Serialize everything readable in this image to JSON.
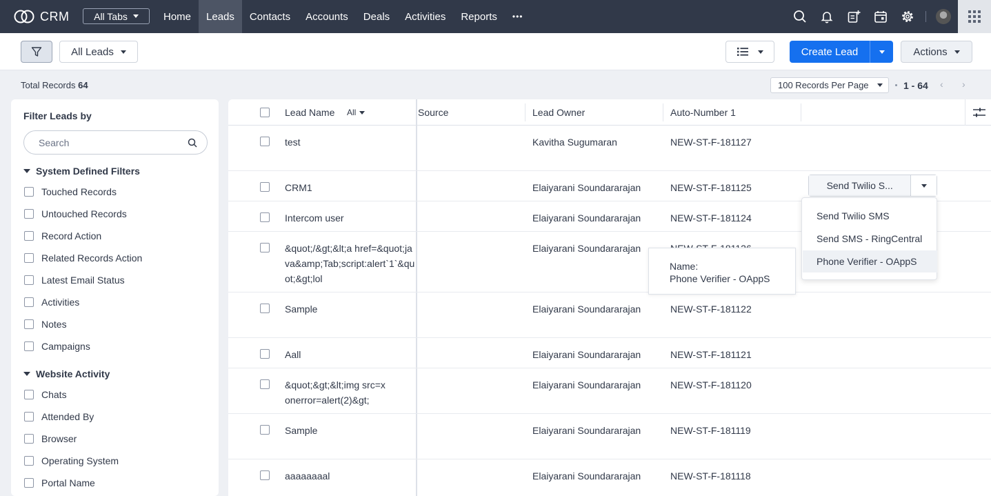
{
  "app": {
    "title": "CRM",
    "all_tabs_label": "All Tabs"
  },
  "nav": {
    "items": [
      {
        "label": "Home",
        "active": false
      },
      {
        "label": "Leads",
        "active": true
      },
      {
        "label": "Contacts",
        "active": false
      },
      {
        "label": "Accounts",
        "active": false
      },
      {
        "label": "Deals",
        "active": false
      },
      {
        "label": "Activities",
        "active": false
      },
      {
        "label": "Reports",
        "active": false
      }
    ],
    "more_label": "•••",
    "icons": [
      "search-icon",
      "bell-icon",
      "add-note-icon",
      "calendar-icon",
      "settings-icon",
      "avatar",
      "app-grid-icon"
    ]
  },
  "toolbar": {
    "view_selector": "All Leads",
    "create_label": "Create Lead",
    "actions_label": "Actions",
    "accent_color": "#1570ef"
  },
  "records": {
    "total_label": "Total Records",
    "total_count": "64",
    "per_page": "100 Records Per Page",
    "range": "1 - 64",
    "prev": "‹",
    "next": "›"
  },
  "filter_panel": {
    "title": "Filter Leads by",
    "search_placeholder": "Search",
    "sections": [
      {
        "title": "System Defined Filters",
        "items": [
          "Touched Records",
          "Untouched Records",
          "Record Action",
          "Related Records Action",
          "Latest Email Status",
          "Activities",
          "Notes",
          "Campaigns"
        ]
      },
      {
        "title": "Website Activity",
        "items": [
          "Chats",
          "Attended By",
          "Browser",
          "Operating System",
          "Portal Name"
        ]
      }
    ]
  },
  "table": {
    "columns": {
      "name": "Lead Name",
      "name_filter": "All",
      "source": "Source",
      "owner": "Lead Owner",
      "auto": "Auto-Number 1"
    },
    "rows": [
      {
        "name": "test",
        "source": "",
        "owner": "Kavitha Sugumaran",
        "auto": "NEW-ST-F-181127"
      },
      {
        "name": "CRM1",
        "source": "",
        "owner": "Elaiyarani Soundararajan",
        "auto": "NEW-ST-F-181125"
      },
      {
        "name": "Intercom user",
        "source": "",
        "owner": "Elaiyarani Soundararajan",
        "auto": "NEW-ST-F-181124"
      },
      {
        "name": "&quot;/&gt;&lt;a href=&quot;java&amp;Tab;script:alert`1`&quot;&gt;lol",
        "source": "",
        "owner": "Elaiyarani Soundararajan",
        "auto": "NEW-ST-F-181126"
      },
      {
        "name": "Sample",
        "source": "",
        "owner": "Elaiyarani Soundararajan",
        "auto": "NEW-ST-F-181122"
      },
      {
        "name": "Aall",
        "source": "",
        "owner": "Elaiyarani Soundararajan",
        "auto": "NEW-ST-F-181121"
      },
      {
        "name": "&quot;&gt;&lt;img src=x onerror=alert(2)&gt;",
        "source": "",
        "owner": "Elaiyarani Soundararajan",
        "auto": "NEW-ST-F-181120"
      },
      {
        "name": "Sample",
        "source": "",
        "owner": "Elaiyarani Soundararajan",
        "auto": "NEW-ST-F-181119"
      },
      {
        "name": "aaaaaaaal",
        "source": "",
        "owner": "Elaiyarani Soundararajan",
        "auto": "NEW-ST-F-181118"
      }
    ],
    "row_action": {
      "label": "Send Twilio S..."
    }
  },
  "dropdown_menu": {
    "items": [
      "Send Twilio SMS",
      "Send SMS - RingCentral",
      "Phone Verifier - OAppS"
    ],
    "hovered_index": 2
  },
  "tooltip": {
    "line1": "Name:",
    "line2": "Phone Verifier - OAppS"
  }
}
